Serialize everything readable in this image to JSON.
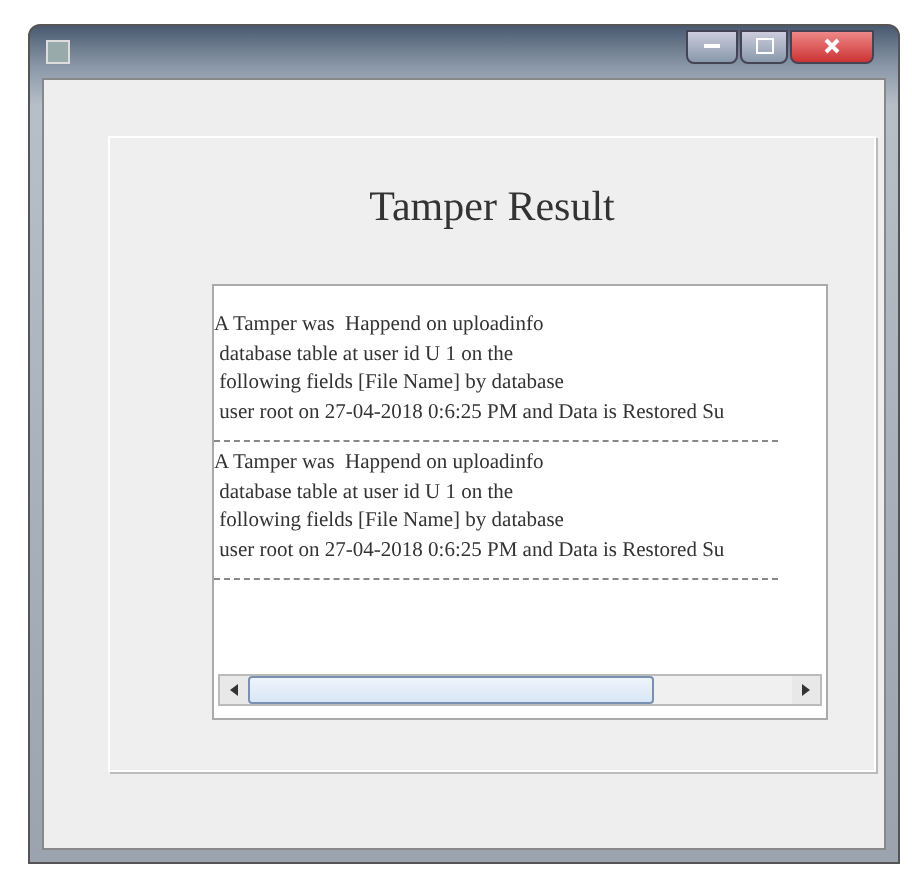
{
  "heading": "Tamper Result",
  "entries": [
    {
      "lines": [
        "A Tamper was  Happend on uploadinfo",
        " database table at user id U 1 on the",
        " following fields [File Name] by database",
        " user root on 27-04-2018 0:6:25 PM and Data is Restored Su"
      ]
    },
    {
      "lines": [
        "A Tamper was  Happend on uploadinfo",
        " database table at user id U 1 on the",
        " following fields [File Name] by database",
        " user root on 27-04-2018 0:6:25 PM and Data is Restored Su"
      ]
    }
  ]
}
